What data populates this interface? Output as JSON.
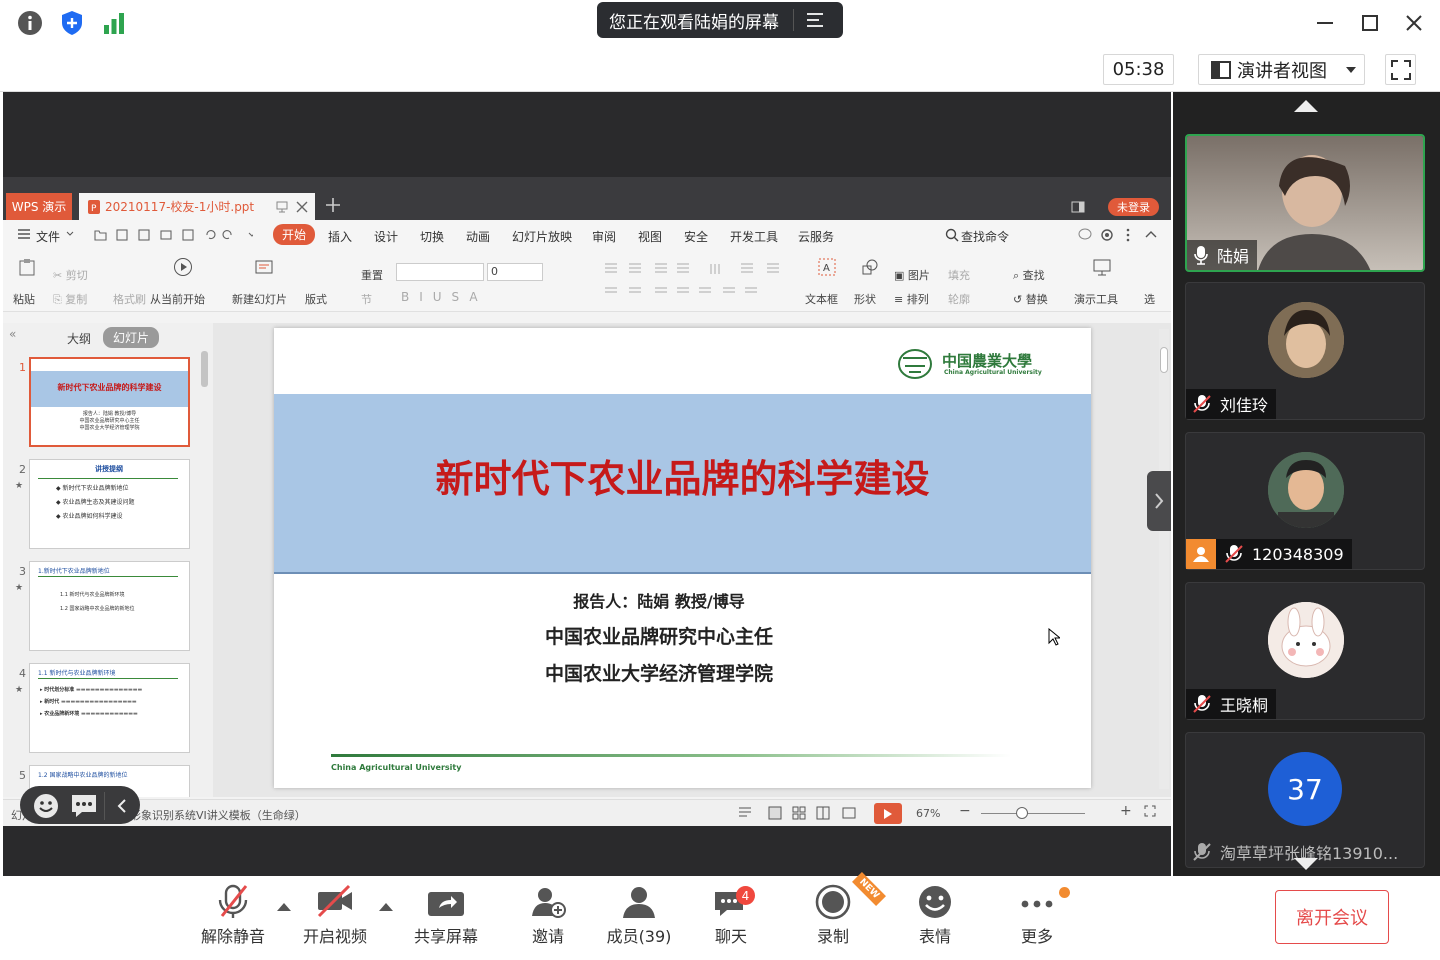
{
  "titlebar": {
    "share_notice": "您正在观看陆娟的屏幕"
  },
  "toolbar": {
    "timer": "05:38",
    "view_mode": "演讲者视图"
  },
  "wps": {
    "app_tab": "WPS 演示",
    "doc_tab": "20210117-校友-1小时.ppt",
    "login": "未登录",
    "menu": [
      "文件",
      "开始",
      "插入",
      "设计",
      "切换",
      "动画",
      "幻灯片放映",
      "审阅",
      "视图",
      "安全",
      "开发工具",
      "云服务"
    ],
    "search_cmd": "查找命令",
    "ribbon": {
      "paste": "粘贴",
      "cut": "剪切",
      "copy": "复制",
      "format_painter": "格式刷",
      "from_current": "从当前开始",
      "new_slide": "新建幻灯片",
      "layout": "版式",
      "reset": "重置",
      "section": "节",
      "font_size": "0",
      "textbox": "文本框",
      "shape": "形状",
      "picture": "图片",
      "arrange": "排列",
      "fill": "填充",
      "outline": "轮廓",
      "find": "查找",
      "replace": "替换",
      "present_tools": "演示工具",
      "select": "选"
    },
    "pane_tabs": [
      "大纲",
      "幻灯片"
    ],
    "thumbs": [
      {
        "num": "1",
        "title": "新时代下农业品牌的科学建设",
        "lines": [
          "报告人：陆娟 教授/博导",
          "中国农业品牌研究中心主任",
          "中国农业大学经济管理学院"
        ]
      },
      {
        "num": "2",
        "title": "讲授提纲",
        "lines": [
          "新时代下农业品牌新地位",
          "农业品牌生态及其建设问题",
          "农业品牌如何科学建设"
        ]
      },
      {
        "num": "3",
        "title": "1.新时代下农业品牌新地位",
        "lines": [
          "1.1 新时代与农业品牌新环境",
          "1.2 国家战略中农业品牌的新地位"
        ]
      },
      {
        "num": "4",
        "title": "1.1 新时代与农业品牌新环境",
        "lines": [
          "时代划分标准",
          "新时代",
          "农业品牌新环境"
        ]
      },
      {
        "num": "5",
        "title": "1.2 国家战略中农业品牌的新地位",
        "lines": []
      }
    ],
    "slide": {
      "logo_cn": "中国農業大學",
      "logo_en": "China Agricultural University",
      "title": "新时代下农业品牌的科学建设",
      "presenter": "报告人：陆娟  教授/博导",
      "line2": "中国农业品牌研究中心主任",
      "line3": "中国农业大学经济管理学院",
      "footer": "China Agricultural University"
    },
    "status": {
      "slide_info": "幻灯片 1 / 48",
      "template": "学校形象识别系统VI讲义模板（生命绿）",
      "zoom": "67%"
    }
  },
  "participants": [
    {
      "name": "陆娟",
      "active": true
    },
    {
      "name": "刘佳玲"
    },
    {
      "name": "120348309"
    },
    {
      "name": "王晓桐"
    },
    {
      "name": "淘草草坪张峰铭13910...",
      "avatar_text": "37"
    }
  ],
  "bottom": {
    "unmute": "解除静音",
    "start_video": "开启视频",
    "share_screen": "共享屏幕",
    "invite": "邀请",
    "members": "成员(39)",
    "chat": "聊天",
    "chat_badge": "4",
    "record": "录制",
    "record_badge": "NEW",
    "emoji": "表情",
    "more": "更多",
    "leave": "离开会议"
  },
  "colors": {
    "wps_accent": "#e05a3a",
    "slide_title": "#c61a1a",
    "slide_band": "#a9c6e5",
    "leave": "#e54b4b",
    "speaking": "#2ea44f"
  }
}
